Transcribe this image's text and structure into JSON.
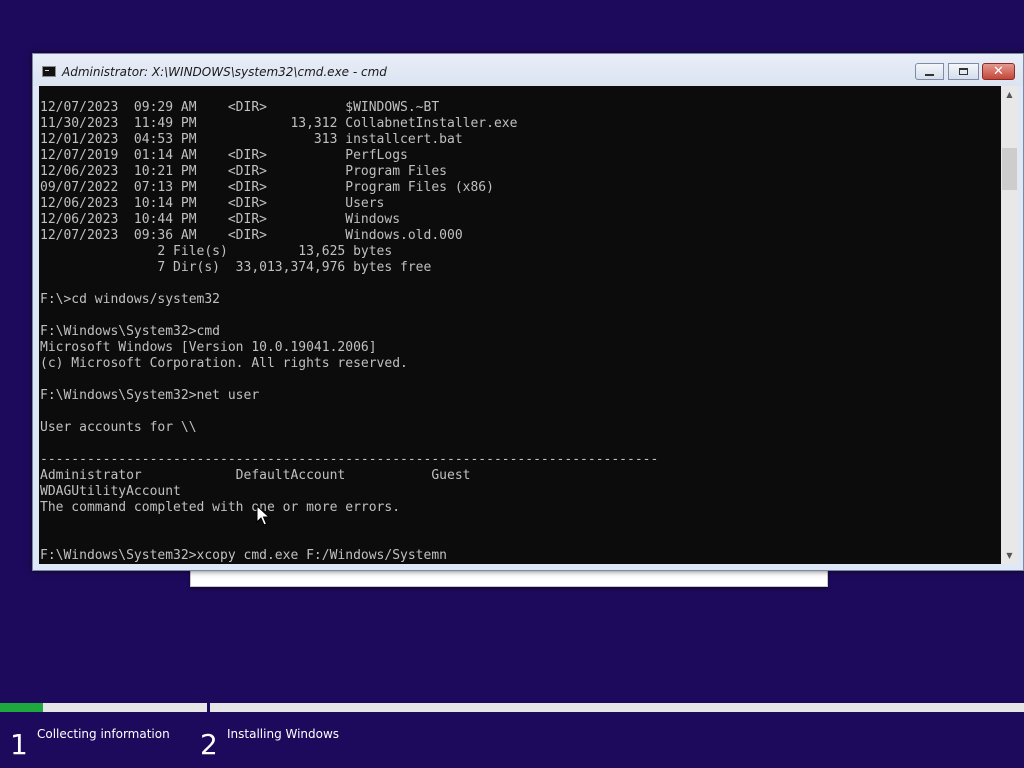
{
  "window": {
    "title": "Administrator: X:\\WINDOWS\\system32\\cmd.exe - cmd",
    "close_glyph": "✕"
  },
  "console": {
    "lines": [
      "12/07/2023  09:29 AM    <DIR>          $WINDOWS.~BT",
      "11/30/2023  11:49 PM            13,312 CollabnetInstaller.exe",
      "12/01/2023  04:53 PM               313 installcert.bat",
      "12/07/2019  01:14 AM    <DIR>          PerfLogs",
      "12/06/2023  10:21 PM    <DIR>          Program Files",
      "09/07/2022  07:13 PM    <DIR>          Program Files (x86)",
      "12/06/2023  10:14 PM    <DIR>          Users",
      "12/06/2023  10:44 PM    <DIR>          Windows",
      "12/07/2023  09:36 AM    <DIR>          Windows.old.000",
      "               2 File(s)         13,625 bytes",
      "               7 Dir(s)  33,013,374,976 bytes free",
      "",
      "F:\\>cd windows/system32",
      "",
      "F:\\Windows\\System32>cmd",
      "Microsoft Windows [Version 10.0.19041.2006]",
      "(c) Microsoft Corporation. All rights reserved.",
      "",
      "F:\\Windows\\System32>net user",
      "",
      "User accounts for \\\\",
      "",
      "-------------------------------------------------------------------------------",
      "Administrator            DefaultAccount           Guest",
      "WDAGUtilityAccount",
      "The command completed with one or more errors.",
      "",
      "",
      "F:\\Windows\\System32>xcopy cmd.exe F:/Windows/Systemn"
    ]
  },
  "setup": {
    "progress_fraction": 0.21,
    "steps": [
      {
        "number": "1",
        "label": "Collecting information"
      },
      {
        "number": "2",
        "label": "Installing Windows"
      }
    ]
  },
  "colors": {
    "desktop_background": "#1e0a5c",
    "progress_fill": "#1fa83d",
    "console_background": "#0c0c0c",
    "console_text": "#c0c0c0"
  }
}
